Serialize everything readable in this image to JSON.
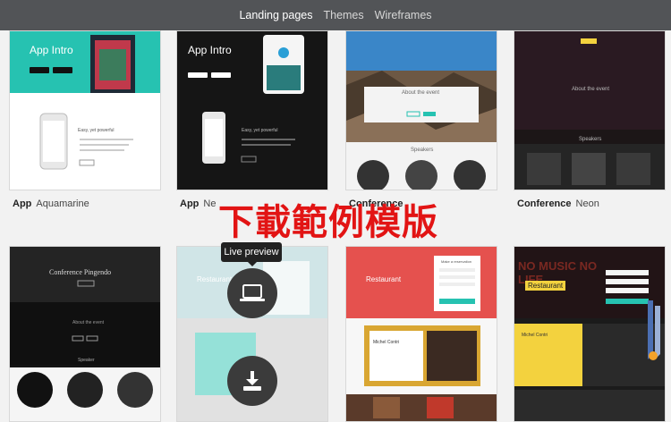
{
  "nav": {
    "items": [
      {
        "label": "Landing pages"
      },
      {
        "label": "Themes"
      },
      {
        "label": "Wireframes"
      }
    ]
  },
  "cards": {
    "card1": {
      "hero_title": "App Intro",
      "caption_bold": "App",
      "caption_rest": "Aquamarine",
      "subtext": "Easy, yet powerful"
    },
    "card2": {
      "hero_title": "App Intro",
      "caption_bold": "App",
      "caption_rest": "Ne",
      "subtext": "Easy, yet powerful"
    },
    "card3": {
      "section": "About the event",
      "speakers": "Speakers",
      "caption_bold": "Conference"
    },
    "card4": {
      "section": "About the event",
      "speakers": "Speakers",
      "caption_bold": "Conference",
      "caption_rest": "Neon"
    },
    "card5": {
      "hero_title": "Conference Pingendo",
      "section": "About the event",
      "speakers": "Speaker"
    },
    "card6": {
      "hero_title": "Restaurant"
    },
    "card7": {
      "hero_title": "Restaurant",
      "form_title": "Make a reservation",
      "chef": "Michel Contri"
    },
    "card8": {
      "hero_title": "Restaurant",
      "hero_bg": "NO MUSIC NO LIFE",
      "chef": "Michel Contri"
    }
  },
  "overlay": {
    "title": "下載範例模版"
  },
  "tooltip": {
    "label": "Live preview"
  },
  "icons": {
    "preview": "laptop-icon",
    "download": "download-icon"
  },
  "colors": {
    "topbar": "#525457",
    "teal": "#26c2b1",
    "overlay_red": "#e21414",
    "restaurant_red": "#e5514e",
    "neon_yellow": "#f3d23e"
  }
}
